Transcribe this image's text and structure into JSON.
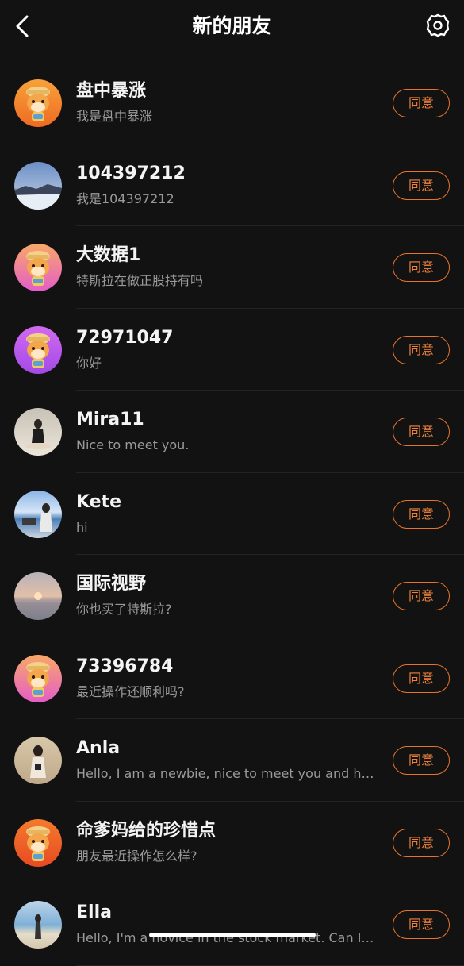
{
  "header": {
    "title": "新的朋友"
  },
  "requests": [
    {
      "name": "盘中暴涨",
      "message": "我是盘中暴涨",
      "button": "同意",
      "avatar": "cartoon-ox-avatar-orange"
    },
    {
      "name": "104397212",
      "message": "我是104397212",
      "button": "同意",
      "avatar": "snowy-landscape-photo"
    },
    {
      "name": "大数据1",
      "message": "特斯拉在做正股持有吗",
      "button": "同意",
      "avatar": "cartoon-ox-avatar-pink"
    },
    {
      "name": "72971047",
      "message": "你好",
      "button": "同意",
      "avatar": "cartoon-ox-avatar-purple"
    },
    {
      "name": "Mira11",
      "message": "Nice to meet you.",
      "button": "同意",
      "avatar": "beach-person-photo"
    },
    {
      "name": "Kete",
      "message": "hi",
      "button": "同意",
      "avatar": "seaside-person-photo"
    },
    {
      "name": "国际视野",
      "message": "你也买了特斯拉?",
      "button": "同意",
      "avatar": "sunset-photo"
    },
    {
      "name": "73396784",
      "message": "最近操作还顺利吗?",
      "button": "同意",
      "avatar": "cartoon-ox-avatar-pink"
    },
    {
      "name": "Anla",
      "message": "Hello, I am a newbie, nice to meet you and hop...",
      "button": "同意",
      "avatar": "indoor-person-photo"
    },
    {
      "name": "命爹妈给的珍惜点",
      "message": "朋友最近操作怎么样?",
      "button": "同意",
      "avatar": "cartoon-ox-avatar-red"
    },
    {
      "name": "Ella",
      "message": "Hello, I'm a novice in the stock market. Can I as...",
      "button": "同意",
      "avatar": "beach-standing-photo"
    }
  ],
  "colors": {
    "background": "#121212",
    "accent": "#e8742c"
  }
}
